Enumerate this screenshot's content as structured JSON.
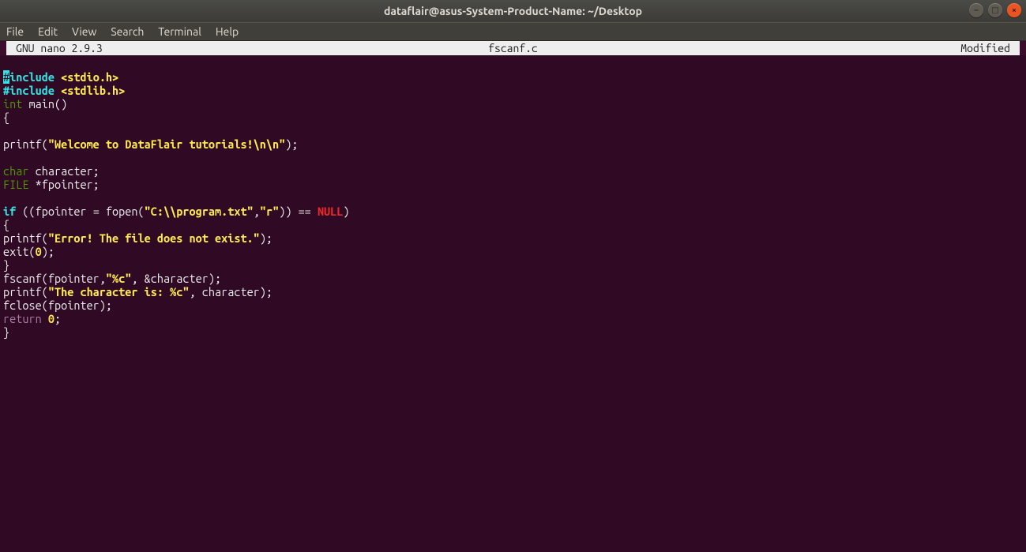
{
  "window": {
    "title": "dataflair@asus-System-Product-Name: ~/Desktop"
  },
  "window_controls": {
    "min_glyph": "–",
    "max_glyph": "□",
    "close_glyph": "×"
  },
  "menubar": {
    "items": [
      "File",
      "Edit",
      "View",
      "Search",
      "Terminal",
      "Help"
    ]
  },
  "nano": {
    "left": "GNU nano 2.9.3",
    "center": "fscanf.c",
    "right": "Modified"
  },
  "code": {
    "l01_cur": "#",
    "l01_a": "include ",
    "l01_b": "<stdio.h>",
    "l02_a": "#include ",
    "l02_b": "<stdlib.h>",
    "l03_a": "int",
    "l03_b": " main()",
    "l04": "{",
    "l05": "",
    "l06_a": "printf(",
    "l06_b": "\"Welcome to DataFlair tutorials!\\n\\n\"",
    "l06_c": ");",
    "l07": "",
    "l08_a": "char",
    "l08_b": " character;",
    "l09_a": "FILE",
    "l09_b": " *fpointer;",
    "l10": "",
    "l11_a": "if",
    "l11_b": " ((fpointer = fopen(",
    "l11_c": "\"C:\\\\program.txt\"",
    "l11_d": ",",
    "l11_e": "\"r\"",
    "l11_f": ")) == ",
    "l11_g": "NULL",
    "l11_h": ")",
    "l12": "{",
    "l13_a": "printf(",
    "l13_b": "\"Error! The file does not exist.\"",
    "l13_c": ");",
    "l14_a": "exit(",
    "l14_b": "0",
    "l14_c": ");",
    "l15": "}",
    "l16_a": "fscanf(fpointer,",
    "l16_b": "\"%c\"",
    "l16_c": ", &character);",
    "l17_a": "printf(",
    "l17_b": "\"The character is: %c\"",
    "l17_c": ", character);",
    "l18": "fclose(fpointer);",
    "l19_a": "return",
    "l19_b": " ",
    "l19_c": "0",
    "l19_d": ";",
    "l20": "}"
  }
}
